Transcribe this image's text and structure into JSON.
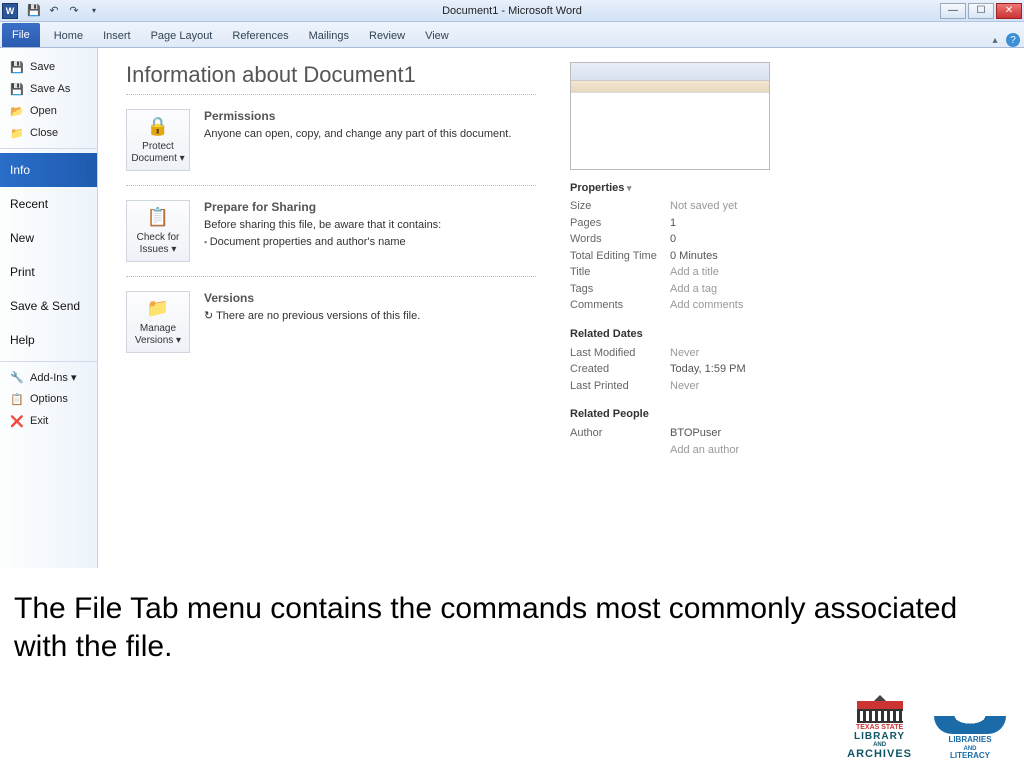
{
  "title": "Document1 - Microsoft Word",
  "ribbon": [
    "File",
    "Home",
    "Insert",
    "Page Layout",
    "References",
    "Mailings",
    "Review",
    "View"
  ],
  "sidebar": {
    "group1": [
      {
        "icon": "💾",
        "label": "Save",
        "name": "save"
      },
      {
        "icon": "💾",
        "label": "Save As",
        "name": "save-as"
      },
      {
        "icon": "📂",
        "label": "Open",
        "name": "open"
      },
      {
        "icon": "📁",
        "label": "Close",
        "name": "close"
      }
    ],
    "group2": [
      {
        "label": "Info",
        "name": "info",
        "sel": true
      },
      {
        "label": "Recent",
        "name": "recent"
      },
      {
        "label": "New",
        "name": "new"
      },
      {
        "label": "Print",
        "name": "print"
      },
      {
        "label": "Save & Send",
        "name": "save-send"
      },
      {
        "label": "Help",
        "name": "help"
      }
    ],
    "group3": [
      {
        "icon": "🔧",
        "label": "Add-Ins ▾",
        "name": "addins"
      },
      {
        "icon": "📋",
        "label": "Options",
        "name": "options"
      },
      {
        "icon": "❌",
        "label": "Exit",
        "name": "exit"
      }
    ]
  },
  "page": {
    "title": "Information about Document1",
    "sections": [
      {
        "tile": {
          "icon": "🔒",
          "l1": "Protect",
          "l2": "Document ▾"
        },
        "h": "Permissions",
        "t": [
          "Anyone can open, copy, and change any part of this document."
        ]
      },
      {
        "tile": {
          "icon": "📋",
          "l1": "Check for",
          "l2": "Issues ▾"
        },
        "h": "Prepare for Sharing",
        "t": [
          "Before sharing this file, be aware that it contains:",
          "Document properties and author's name"
        ],
        "bullet": 1
      },
      {
        "tile": {
          "icon": "📁",
          "l1": "Manage",
          "l2": "Versions ▾"
        },
        "h": "Versions",
        "t": [
          "There are no previous versions of this file."
        ],
        "ticon": "↻"
      }
    ],
    "properties": {
      "header": "Properties",
      "rows": [
        {
          "l": "Size",
          "v": "Not saved yet"
        },
        {
          "l": "Pages",
          "v": "1",
          "dk": true
        },
        {
          "l": "Words",
          "v": "0",
          "dk": true
        },
        {
          "l": "Total Editing Time",
          "v": "0 Minutes",
          "dk": true
        },
        {
          "l": "Title",
          "v": "Add a title"
        },
        {
          "l": "Tags",
          "v": "Add a tag"
        },
        {
          "l": "Comments",
          "v": "Add comments"
        }
      ],
      "dates": {
        "h": "Related Dates",
        "rows": [
          {
            "l": "Last Modified",
            "v": "Never"
          },
          {
            "l": "Created",
            "v": "Today, 1:59 PM",
            "dk": true
          },
          {
            "l": "Last Printed",
            "v": "Never"
          }
        ]
      },
      "people": {
        "h": "Related People",
        "rows": [
          {
            "l": "Author",
            "v": "BTOPuser",
            "dk": true
          },
          {
            "l": "",
            "v": "Add an author"
          }
        ]
      }
    }
  },
  "caption": "The File Tab menu contains the commands most commonly associated with the file.",
  "logo1": {
    "t1": "TEXAS STATE",
    "t2": "LIBRARY",
    "t3": "ARCHIVES",
    "amp": "AND"
  },
  "logo2": {
    "l1": "LIBRARIES",
    "amp": "AND",
    "l2": "LITERACY"
  }
}
